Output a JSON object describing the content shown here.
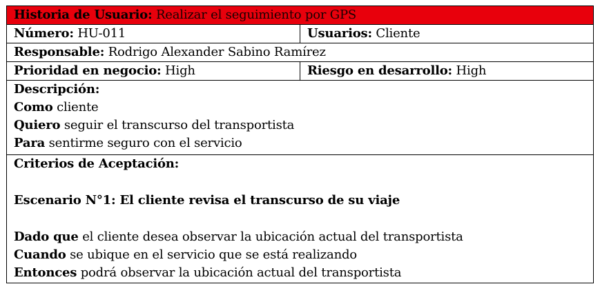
{
  "title": {
    "label": "Historia de Usuario:",
    "value": "Realizar el seguimiento por GPS",
    "background_color": "#e8000c"
  },
  "numero": {
    "label": "Número:",
    "value": "HU-011"
  },
  "usuarios": {
    "label": "Usuarios:",
    "value": "Cliente"
  },
  "responsable": {
    "label": "Responsable:",
    "value": "Rodrigo Alexander Sabino Ramírez"
  },
  "prioridad": {
    "label": "Prioridad en negocio:",
    "value": "High"
  },
  "riesgo": {
    "label": "Riesgo en desarrollo:",
    "value": "High"
  },
  "descripcion": {
    "heading": "Descripción:",
    "como_label": "Como",
    "como_value": "cliente",
    "quiero_label": "Quiero",
    "quiero_value": "seguir el transcurso del transportista",
    "para_label": "Para",
    "para_value": "sentirme seguro con el servicio"
  },
  "criterios": {
    "heading": "Criterios de Aceptación:",
    "escenario": "Escenario N°1: El cliente revisa el transcurso de su viaje",
    "dado_label": "Dado que",
    "dado_value": "el cliente desea observar la ubicación actual del transportista",
    "cuando_label": "Cuando",
    "cuando_value": "se ubique en el servicio que se está realizando",
    "entonces_label": "Entonces",
    "entonces_value": "podrá observar la ubicación actual del transportista"
  }
}
